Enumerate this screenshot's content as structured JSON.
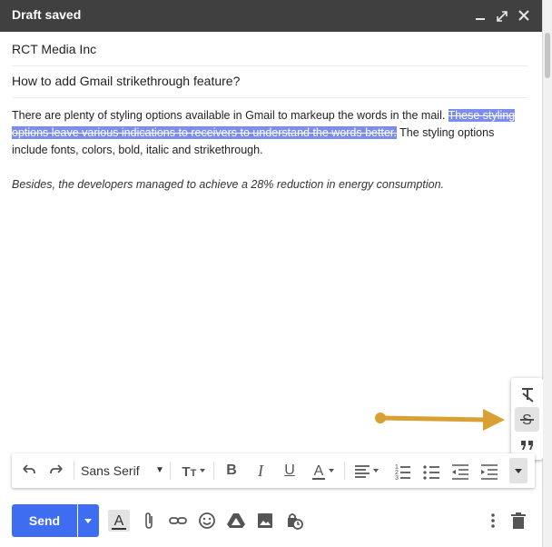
{
  "window": {
    "title": "Draft saved",
    "minimize": "–",
    "expand": "⤢",
    "close": "✕"
  },
  "compose": {
    "to": "RCT Media Inc",
    "subject": "How to add Gmail strikethrough feature?",
    "body": {
      "p1_normal_start": "There are plenty of styling options available in Gmail to markeup the words in the mail. ",
      "p1_struck": "These styling options leave various indications to receivers to understand the words better.",
      "p1_normal_end": " The styling options include fonts, colors, bold, italic and strikethrough.",
      "p2": "Besides, the developers managed to achieve a 28% reduction in energy consumption."
    }
  },
  "more_formatting_popup": {
    "items": [
      {
        "icon": "remove-formatting-icon",
        "glyph": "T̸",
        "active": false
      },
      {
        "icon": "strikethrough-icon",
        "glyph": "S̶",
        "active": true
      },
      {
        "icon": "quote-icon",
        "glyph": "❞",
        "active": false
      }
    ]
  },
  "toolbar": {
    "undo": "↶",
    "redo": "↷",
    "font": "Sans Serif",
    "size": "T",
    "bold": "B",
    "italic": "I",
    "underline": "U",
    "text_color": "A",
    "align": "≡",
    "numbered_list": "1≡",
    "bulleted_list": "•≡",
    "indent_less": "⇤",
    "indent_more": "⇥",
    "more": "▾"
  },
  "footer": {
    "send_label": "Send",
    "icons": [
      "formatting-icon",
      "attach-icon",
      "link-icon",
      "emoji-icon",
      "drive-icon",
      "photo-icon",
      "confidential-icon"
    ]
  },
  "colors": {
    "accent": "#3e6df2",
    "highlight": "#7b8ef0",
    "arrow": "#d9a133",
    "titlebar": "#404040"
  }
}
